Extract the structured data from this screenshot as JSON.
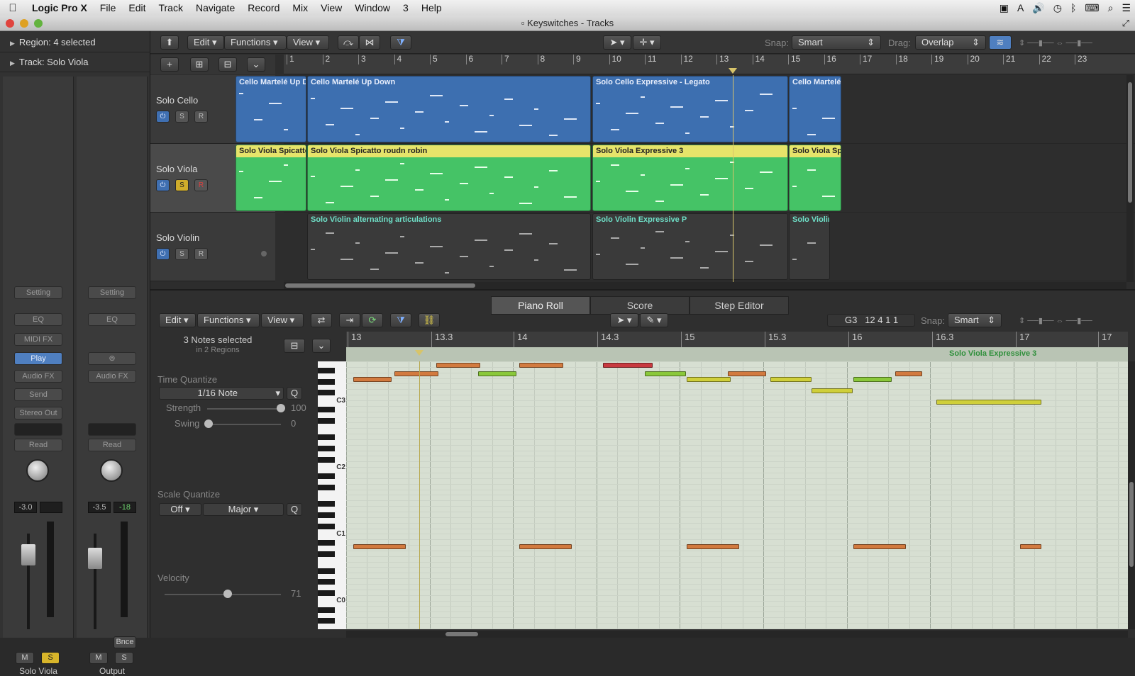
{
  "menubar": {
    "app": "Logic Pro X",
    "items": [
      "File",
      "Edit",
      "Track",
      "Navigate",
      "Record",
      "Mix",
      "View",
      "Window",
      "3",
      "Help"
    ]
  },
  "window": {
    "title": "Keyswitches - Tracks"
  },
  "inspector": {
    "region_label": "Region: 4 selected",
    "track_label": "Track:  Solo Viola",
    "strips": [
      {
        "setting": "Setting",
        "eq": "EQ",
        "midifx": "MIDI FX",
        "instrument": "Play",
        "audiofx": "Audio FX",
        "send": "Send",
        "output": "Stereo Out",
        "automation": "Read",
        "vol": "-3.0",
        "peak": "",
        "mute": "M",
        "solo": "S",
        "name": "Solo Viola"
      },
      {
        "setting": "Setting",
        "eq": "EQ",
        "link": "⊚",
        "audiofx": "Audio FX",
        "automation": "Read",
        "vol": "-3.5",
        "peak": "-18",
        "bounce": "Bnce",
        "mute": "M",
        "solo": "S",
        "name": "Output"
      }
    ]
  },
  "tracks_toolbar": {
    "edit": "Edit",
    "functions": "Functions",
    "view": "View",
    "snap_label": "Snap:",
    "snap_value": "Smart",
    "drag_label": "Drag:",
    "drag_value": "Overlap"
  },
  "ruler_bars": [
    "1",
    "2",
    "3",
    "4",
    "5",
    "6",
    "7",
    "8",
    "9",
    "10",
    "11",
    "12",
    "13",
    "14",
    "15",
    "16",
    "17",
    "18",
    "19",
    "20",
    "21",
    "22",
    "23"
  ],
  "tracks": [
    {
      "name": "Solo Cello",
      "power": "⏻",
      "solo": "S",
      "rec": "R",
      "regions": [
        {
          "name": "Cello Martelé Up D"
        },
        {
          "name": "Cello Martelé Up Down"
        },
        {
          "name": "Solo Cello Expressive - Legato"
        },
        {
          "name": "Cello Martelé"
        }
      ]
    },
    {
      "name": "Solo Viola",
      "power": "⏻",
      "solo": "S",
      "rec": "R",
      "regions": [
        {
          "name": "Solo Viola Spicatto"
        },
        {
          "name": "Solo Viola Spicatto roudn robin"
        },
        {
          "name": "Solo Viola Expressive 3"
        },
        {
          "name": "Solo Viola Spi"
        }
      ]
    },
    {
      "name": "Solo Violin",
      "power": "⏻",
      "solo": "S",
      "rec": "R",
      "regions": [
        {
          "name": "Solo Violin alternating articulations"
        },
        {
          "name": "Solo Violin Expressive P"
        },
        {
          "name": "Solo Violin"
        }
      ]
    }
  ],
  "editor": {
    "tabs": [
      "Piano Roll",
      "Score",
      "Step Editor"
    ],
    "edit": "Edit",
    "functions": "Functions",
    "view": "View",
    "position_note": "G3",
    "position_value": "12 4 1 1",
    "snap_label": "Snap:",
    "snap_value": "Smart",
    "selection": "3 Notes selected",
    "selection_sub": "in 2 Regions",
    "time_quantize_label": "Time Quantize",
    "time_quantize_value": "1/16 Note",
    "q": "Q",
    "strength_label": "Strength",
    "strength_value": "100",
    "swing_label": "Swing",
    "swing_value": "0",
    "scale_quantize_label": "Scale Quantize",
    "scale_off": "Off",
    "scale_major": "Major",
    "velocity_label": "Velocity",
    "velocity_value": "71",
    "ruler": [
      "13",
      "13.3",
      "14",
      "14.3",
      "15",
      "15.3",
      "16",
      "16.3",
      "17",
      "17"
    ],
    "region_name": "Solo Viola Expressive 3",
    "key_labels": [
      "C3",
      "C2",
      "C1",
      "C0"
    ]
  },
  "colors": {
    "region_blue": "#3d6fb0",
    "region_green": "#45c366",
    "region_header_yellow": "#e6e46a",
    "note_orange": "#d27a3f",
    "note_red": "#c8393f",
    "note_green": "#8ac83a",
    "note_yellow": "#cfcf3a"
  }
}
